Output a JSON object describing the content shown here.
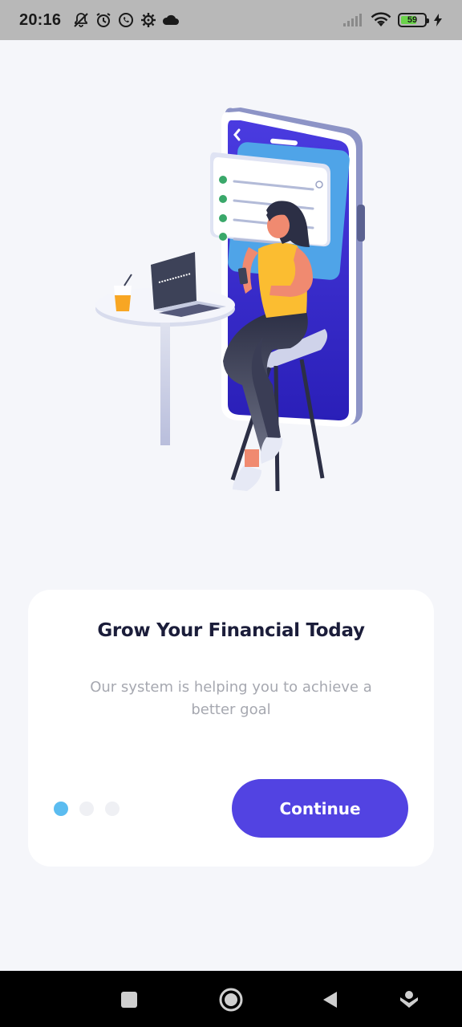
{
  "status_bar": {
    "time": "20:16",
    "battery_level": "59",
    "icons": [
      "muted-bell-icon",
      "alarm-icon",
      "whatsapp-icon",
      "settings-gear-icon",
      "cloud-icon",
      "signal-icon",
      "wifi-icon",
      "battery-icon",
      "charging-bolt-icon"
    ]
  },
  "onboarding": {
    "title": "Grow Your Financial Today",
    "description": "Our system is helping you to achieve a better goal",
    "continue_label": "Continue",
    "pages_total": 3,
    "current_page": 1
  },
  "nav_bar": {
    "icons": [
      "recent-apps-icon",
      "home-icon",
      "back-icon",
      "assistant-icon"
    ]
  },
  "colors": {
    "accent": "#5243e2",
    "dot_active": "#5bbcf0",
    "title": "#1b1d3a",
    "description": "#a6a8b0",
    "background": "#f5f6fa"
  }
}
